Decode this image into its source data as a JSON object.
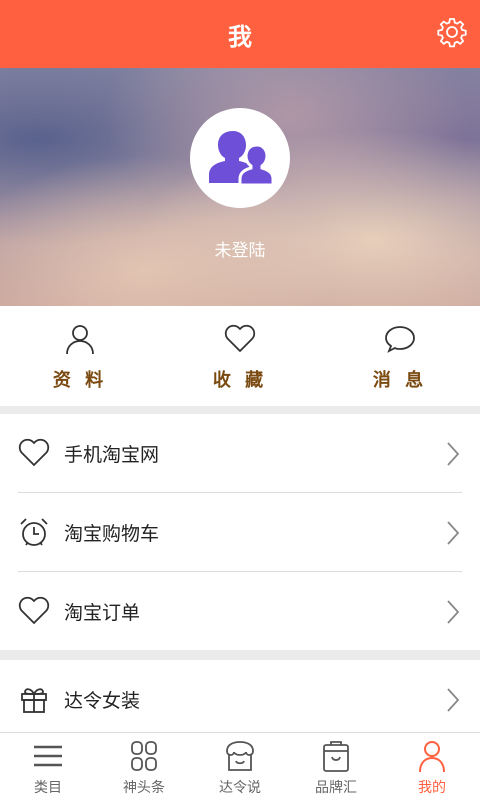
{
  "header": {
    "title": "我",
    "settings_icon": "gear-icon"
  },
  "profile": {
    "login_status": "未登陆",
    "avatar_icon": "user-group-icon",
    "avatar_color": "#6e4fd8"
  },
  "quick_actions": [
    {
      "label": "资 料",
      "icon": "person-icon"
    },
    {
      "label": "收 藏",
      "icon": "heart-icon"
    },
    {
      "label": "消 息",
      "icon": "chat-bubble-icon"
    }
  ],
  "list1": [
    {
      "label": "手机淘宝网",
      "icon": "heart-icon"
    },
    {
      "label": "淘宝购物车",
      "icon": "alarm-clock-icon"
    },
    {
      "label": "淘宝订单",
      "icon": "heart-icon"
    }
  ],
  "list2": [
    {
      "label": "达令女装",
      "icon": "gift-icon"
    }
  ],
  "tabbar": {
    "items": [
      {
        "label": "类目",
        "icon": "menu-icon"
      },
      {
        "label": "神头条",
        "icon": "grid-icon"
      },
      {
        "label": "达令说",
        "icon": "shop-icon"
      },
      {
        "label": "品牌汇",
        "icon": "bag-icon"
      },
      {
        "label": "我的",
        "icon": "person-icon"
      }
    ],
    "active_index": 4
  },
  "colors": {
    "accent": "#ff6040",
    "quick_label": "#7a4a10"
  }
}
